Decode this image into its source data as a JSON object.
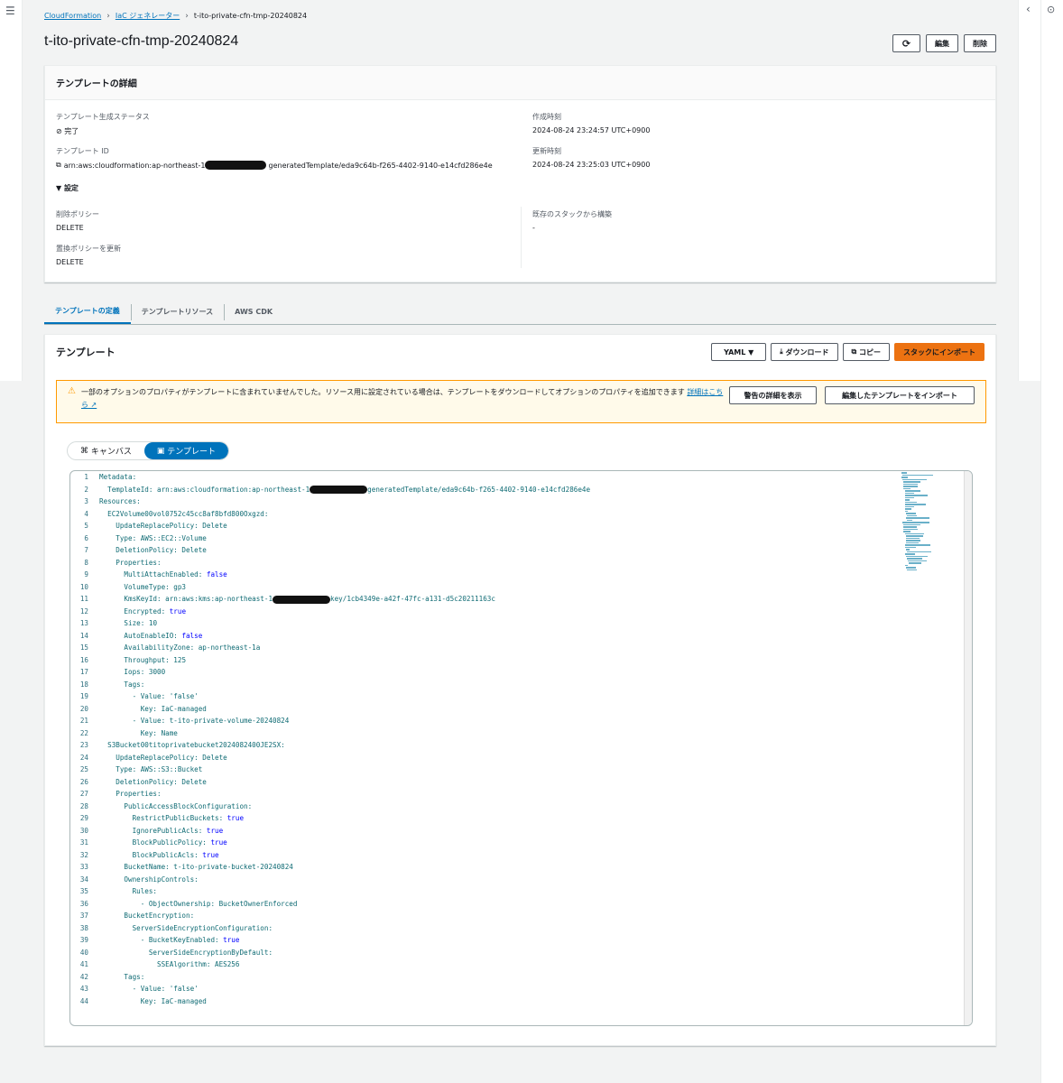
{
  "breadcrumb": {
    "item1": "CloudFormation",
    "item2": "IaC ジェネレーター",
    "current": "t-ito-private-cfn-tmp-20240824"
  },
  "page": {
    "title": "t-ito-private-cfn-tmp-20240824"
  },
  "header_buttons": {
    "refresh_icon": "refresh-icon",
    "edit": "編集",
    "delete": "削除"
  },
  "details": {
    "title": "テンプレートの詳細",
    "status_label": "テンプレート生成ステータス",
    "status_value": "完了",
    "id_label": "テンプレート ID",
    "id_prefix": "arn:aws:cloudformation:ap-northeast-1",
    "id_suffix": "generatedTemplate/eda9c64b-f265-4402-9140-e14cfd286e4e",
    "created_label": "作成時刻",
    "created_value": "2024-08-24 23:24:57 UTC+0900",
    "updated_label": "更新時刻",
    "updated_value": "2024-08-24 23:25:03 UTC+0900",
    "settings_toggle": "▼ 設定",
    "deletion_label": "削除ポリシー",
    "deletion_value": "DELETE",
    "replace_label": "置換ポリシーを更新",
    "replace_value": "DELETE",
    "existing_label": "既存のスタックから構築",
    "existing_value": "-"
  },
  "tabs": [
    "テンプレートの定義",
    "テンプレートリソース",
    "AWS CDK"
  ],
  "template": {
    "title": "テンプレート",
    "format": "YAML ▼",
    "download": "ダウンロード",
    "copy": "コピー",
    "import": "スタックにインポート"
  },
  "alert": {
    "message": "一部のオプションのプロパティがテンプレートに含まれていませんでした。リソース用に設定されている場合は、テンプレートをダウンロードしてオプションのプロパティを追加できます",
    "link": "詳細はこちら",
    "show_details": "警告の詳細を表示",
    "import_edited": "編集したテンプレートをインポート"
  },
  "view_toggle": {
    "canvas": "キャンバス",
    "template": "テンプレート"
  },
  "code_lines": [
    "Metadata:",
    "  TemplateId: arn:aws:cloudformation:ap-northeast-1",
    "Resources:",
    "  EC2Volume00vol0752c45cc8af8bfd800Oxgzd:",
    "    UpdateReplacePolicy: Delete",
    "    Type: AWS::EC2::Volume",
    "    DeletionPolicy: Delete",
    "    Properties:",
    "      MultiAttachEnabled: false",
    "      VolumeType: gp3",
    "      KmsKeyId: arn:aws:kms:ap-northeast-1",
    "      Encrypted: true",
    "      Size: 10",
    "      AutoEnableIO: false",
    "      AvailabilityZone: ap-northeast-1a",
    "      Throughput: 125",
    "      Iops: 3000",
    "      Tags:",
    "        - Value: 'false'",
    "          Key: IaC-managed",
    "        - Value: t-ito-private-volume-20240824",
    "          Key: Name",
    "  S3Bucket00titoprivatebucket2024082400JE2SX:",
    "    UpdateReplacePolicy: Delete",
    "    Type: AWS::S3::Bucket",
    "    DeletionPolicy: Delete",
    "    Properties:",
    "      PublicAccessBlockConfiguration:",
    "        RestrictPublicBuckets: true",
    "        IgnorePublicAcls: true",
    "        BlockPublicPolicy: true",
    "        BlockPublicAcls: true",
    "      BucketName: t-ito-private-bucket-20240824",
    "      OwnershipControls:",
    "        Rules:",
    "          - ObjectOwnership: BucketOwnerEnforced",
    "      BucketEncryption:",
    "        ServerSideEncryptionConfiguration:",
    "          - BucketKeyEnabled: true",
    "            ServerSideEncryptionByDefault:",
    "              SSEAlgorithm: AES256",
    "      Tags:",
    "        - Value: 'false'",
    "          Key: IaC-managed"
  ],
  "code_suffix_line2": "generatedTemplate/eda9c64b-f265-4402-9140-e14cfd286e4e",
  "code_suffix_line11": "key/1cb4349e-a42f-47fc-a131-d5c20211163c"
}
